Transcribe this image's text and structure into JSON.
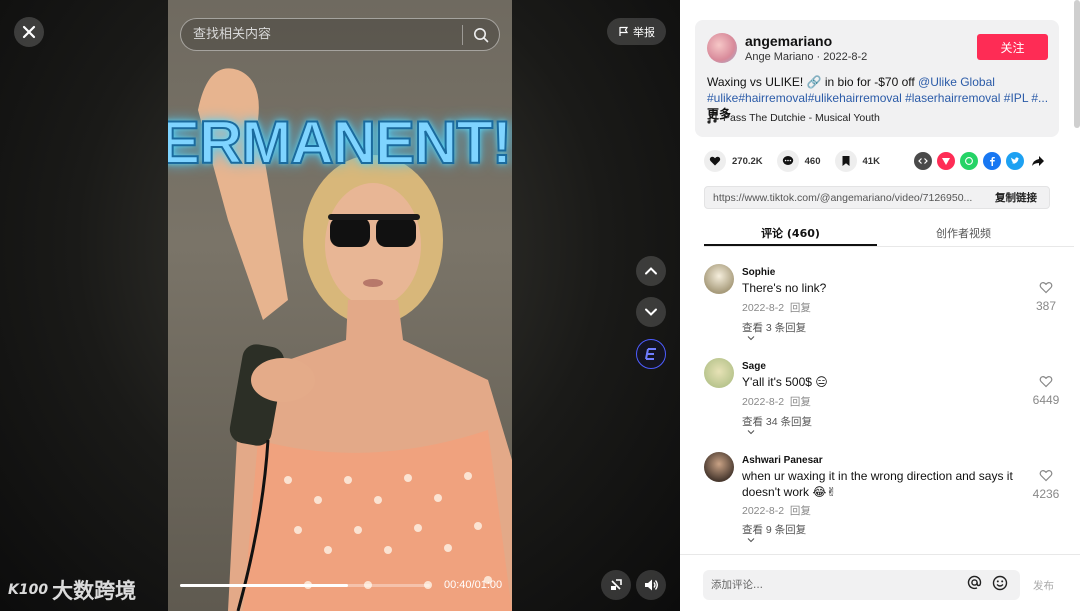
{
  "video": {
    "overlay_text": "ERMANENT!!",
    "search_placeholder": "查找相关内容",
    "report_label": "举报",
    "time": "00:40/01:00",
    "progress": 0.67,
    "watermark": "大数跨境",
    "watermark_logo": "K100"
  },
  "author": {
    "username": "angemariano",
    "display": "Ange Mariano · 2022-8-2",
    "follow_label": "关注",
    "desc_prefix": "Waxing vs ULIKE! 🔗 in bio for -$70 off ",
    "mention": "@Ulike Global",
    "hashtags": " #ulike#hairremoval#ulikehairremoval #laserhairremoval #IPL #...",
    "more_label": "更多",
    "music": "Pass The Dutchie - Musical Youth"
  },
  "stats": {
    "likes": "270.2K",
    "comments": "460",
    "saves": "41K"
  },
  "share_link": {
    "url": "https://www.tiktok.com/@angemariano/video/7126950...",
    "copy_label": "复制链接"
  },
  "tabs": {
    "comments": "评论 (460)",
    "creator_videos": "创作者视频"
  },
  "comments": [
    {
      "user": "Sophie",
      "text": "There's no link?",
      "date": "2022-8-2",
      "reply_label": "回复",
      "view_replies": "查看 3 条回复",
      "likes": "387"
    },
    {
      "user": "Sage",
      "text": "Y'all it's 500$ 😑",
      "date": "2022-8-2",
      "reply_label": "回复",
      "view_replies": "查看 34 条回复",
      "likes": "6449"
    },
    {
      "user": "Ashwari Panesar",
      "text": "when ur waxing it in the wrong direction and says it doesn't work 😂✌",
      "date": "2022-8-2",
      "reply_label": "回复",
      "view_replies": "查看 9 条回复",
      "likes": "4236"
    }
  ],
  "comment_box": {
    "placeholder": "添加评论...",
    "post_label": "发布"
  },
  "colors": {
    "accent_red": "#fe2c55",
    "hashtag_blue": "#2b5ba8",
    "panel_grey": "#f1f1f2"
  }
}
